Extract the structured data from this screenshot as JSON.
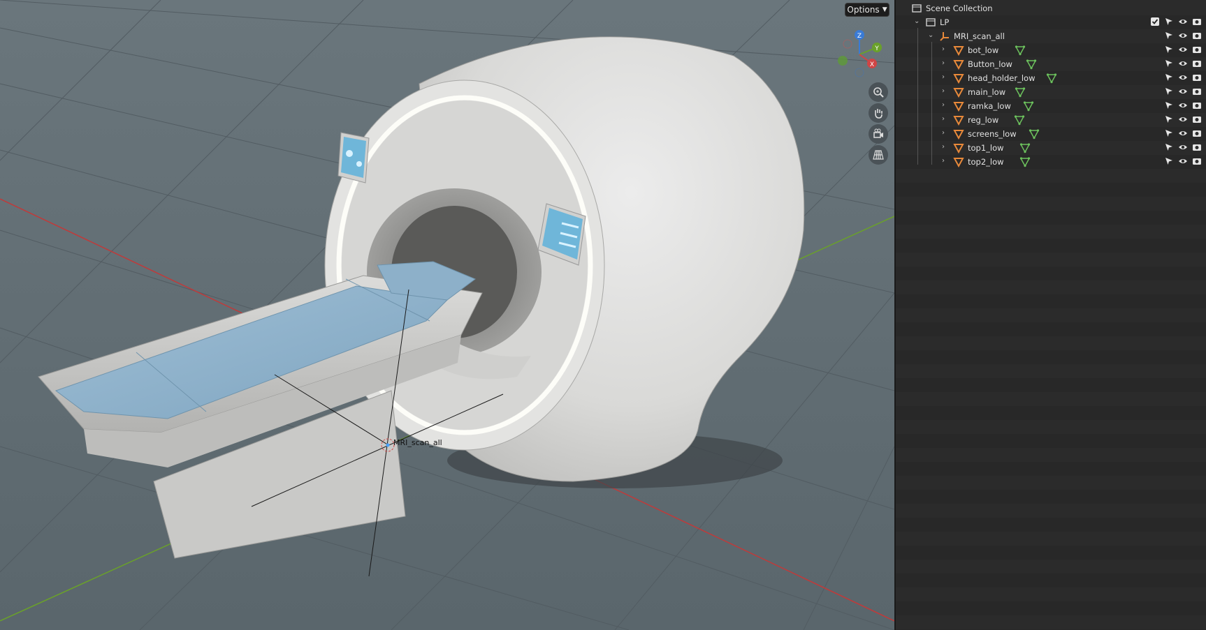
{
  "viewport": {
    "options_label": "Options",
    "active_object_label": "MRI_scan_all",
    "gizmo_axes": {
      "z": "Z",
      "y": "Y",
      "x": "X"
    },
    "nav_icons": [
      "zoom-icon",
      "hand-pan-icon",
      "camera-icon",
      "grid-perspective-icon"
    ],
    "colors": {
      "x_axis": "#c03a3a",
      "y_axis": "#6aa12a",
      "grid": "#525c62"
    }
  },
  "outliner": {
    "root": {
      "label": "Scene Collection"
    },
    "collection": {
      "label": "LP"
    },
    "parent": {
      "label": "MRI_scan_all"
    },
    "objects": [
      {
        "label": "bot_low"
      },
      {
        "label": "Button_low"
      },
      {
        "label": "head_holder_low"
      },
      {
        "label": "main_low"
      },
      {
        "label": "ramka_low"
      },
      {
        "label": "reg_low"
      },
      {
        "label": "screens_low"
      },
      {
        "label": "top1_low"
      },
      {
        "label": "top2_low"
      }
    ],
    "colors": {
      "mesh_icon": "#e8893a",
      "modifier_icon": "#6cc15d",
      "empty_icon": "#e8893a"
    }
  }
}
